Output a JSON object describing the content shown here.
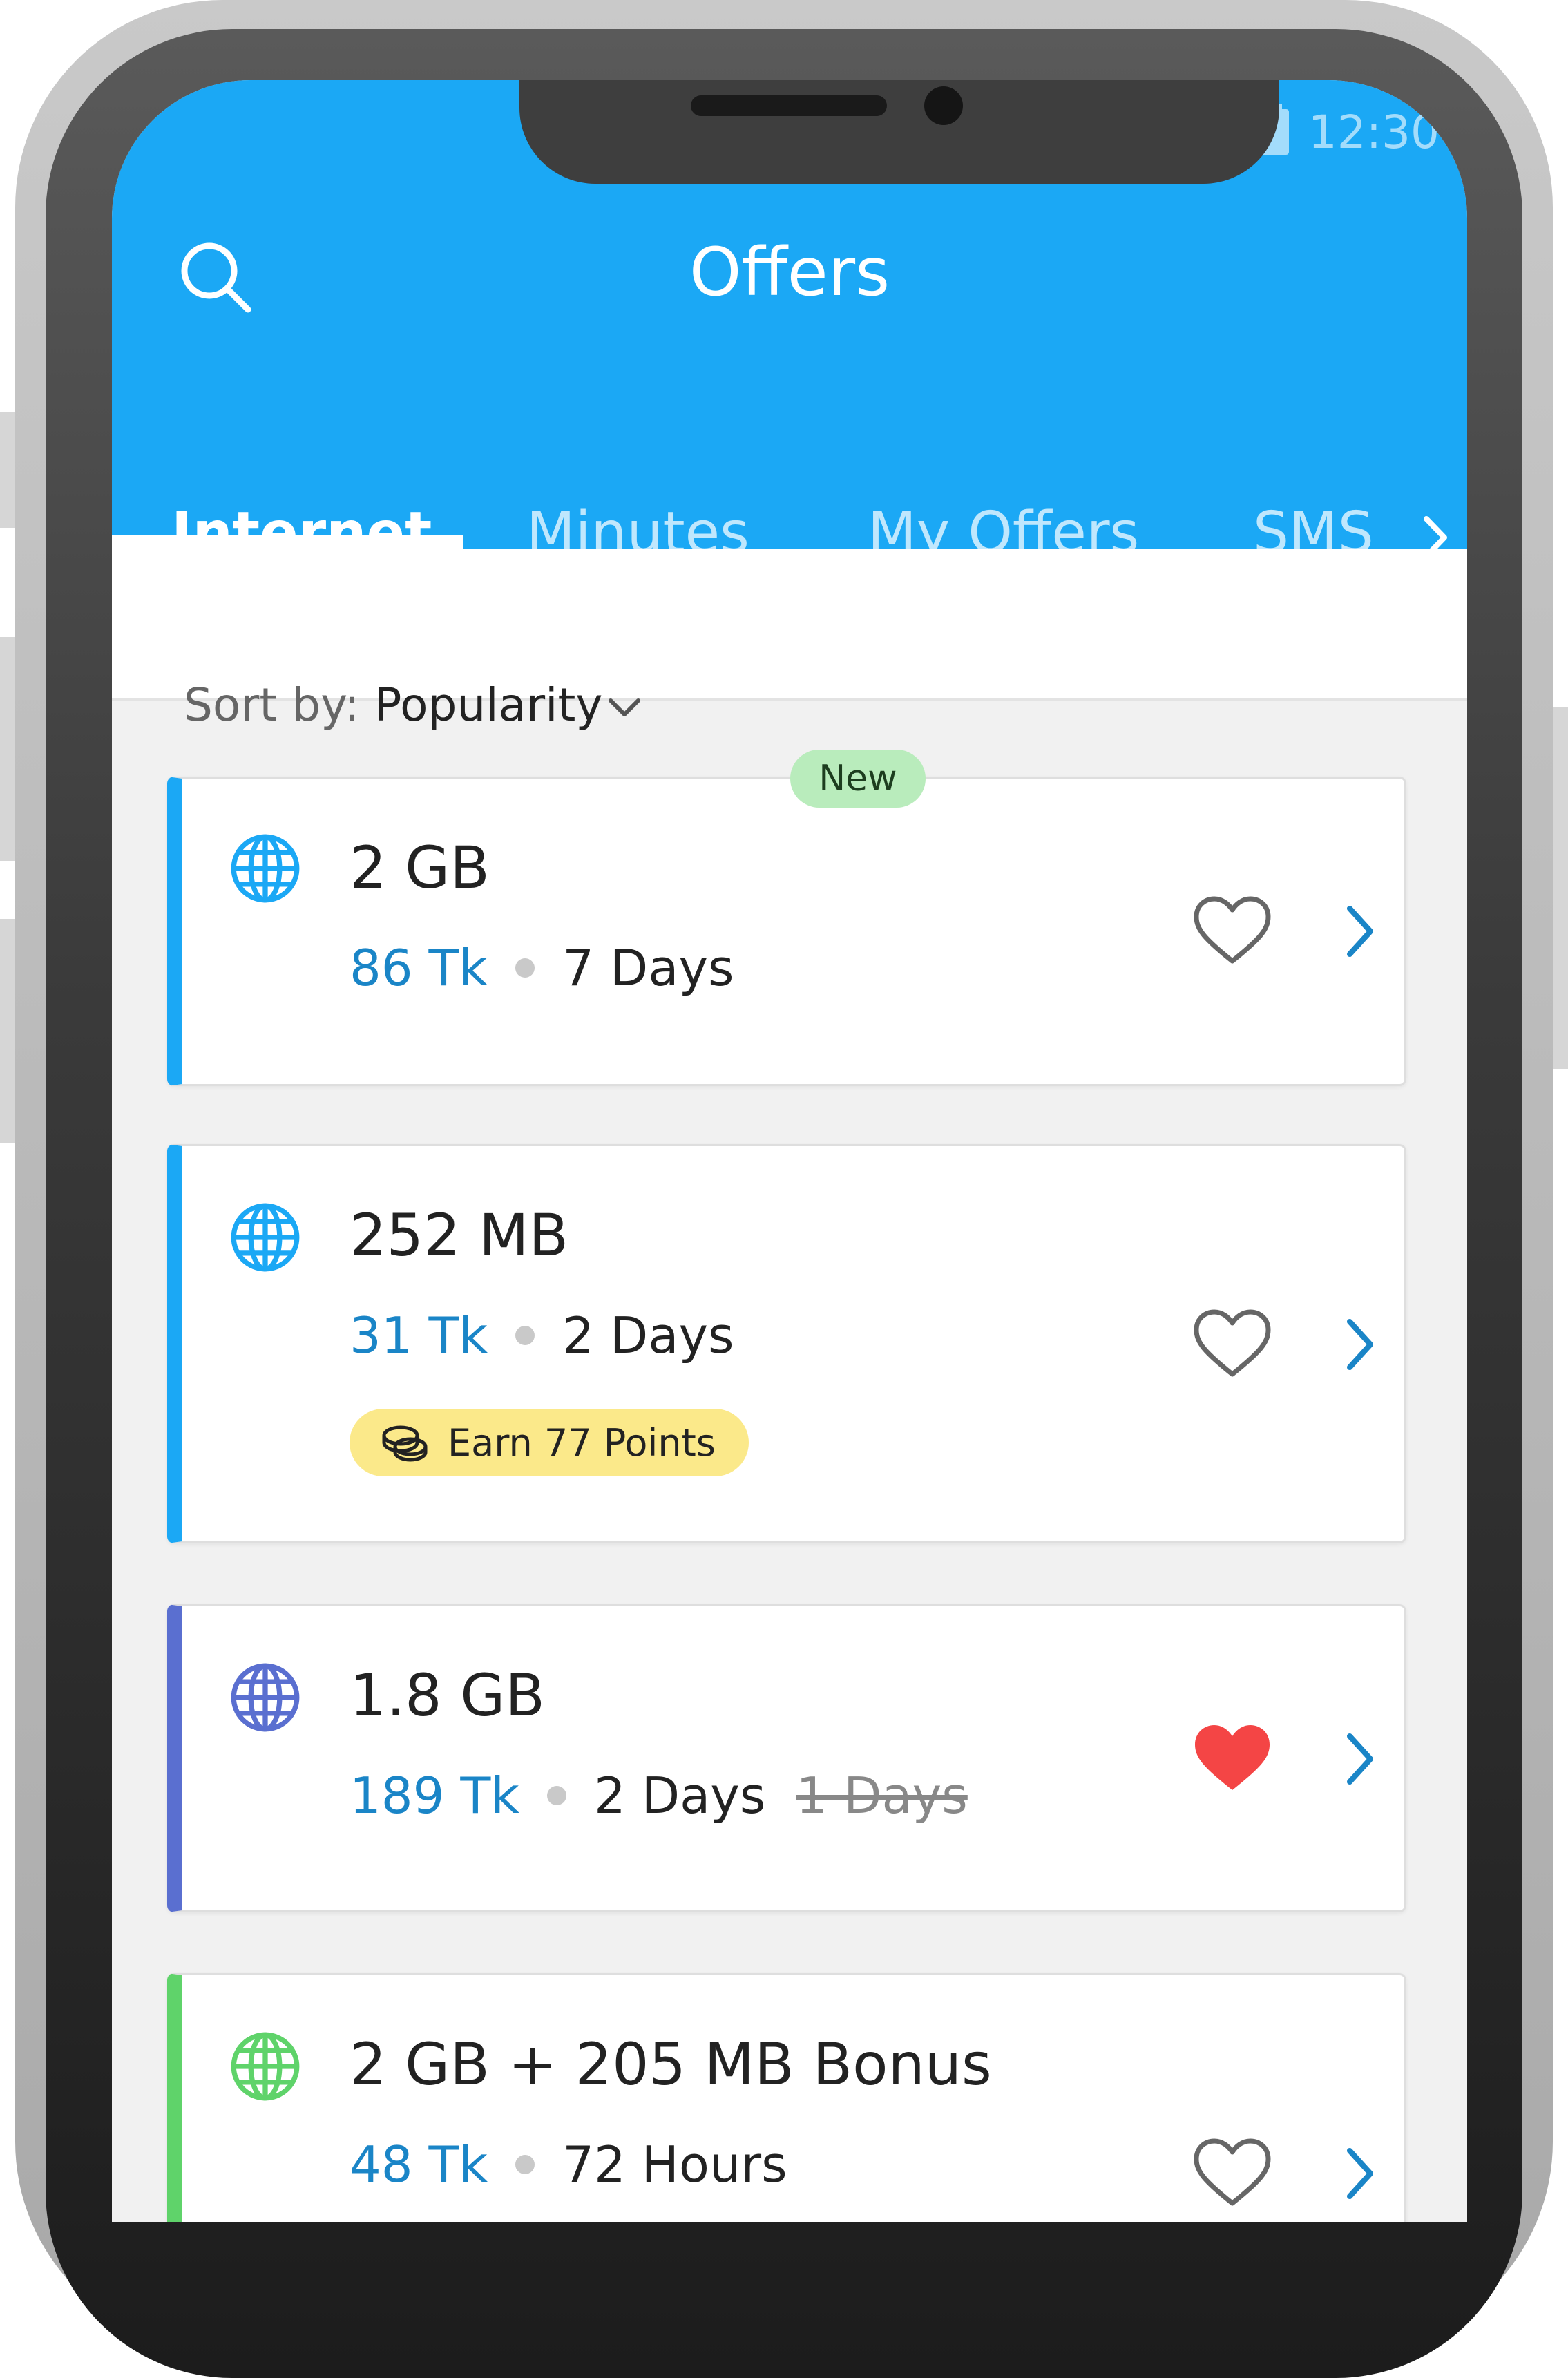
{
  "status_bar": {
    "time": "12:30"
  },
  "header": {
    "title": "Offers",
    "search_icon": "search-icon"
  },
  "tabs": [
    {
      "label": "Internet",
      "active": true
    },
    {
      "label": "Minutes",
      "active": false
    },
    {
      "label": "My Offers",
      "active": false
    },
    {
      "label": "SMS",
      "active": false
    }
  ],
  "sort": {
    "label": "Sort by:",
    "value": "Popularity"
  },
  "offers": [
    {
      "title": "2 GB",
      "price": "86 Tk",
      "duration": "7 Days",
      "badge": "New",
      "favorite": false,
      "accent": "#1ba8f5"
    },
    {
      "title": "252 MB",
      "price": "31 Tk",
      "duration": "2 Days",
      "points": "Earn 77 Points",
      "favorite": false,
      "accent": "#1ba8f5"
    },
    {
      "title": "1.8 GB",
      "price": "189 Tk",
      "duration": "2 Days",
      "old_duration": "1 Days",
      "favorite": true,
      "accent": "#5a6fd0"
    },
    {
      "title": "2 GB + 205 MB Bonus",
      "price": "48 Tk",
      "duration": "72 Hours",
      "favorite": false,
      "accent": "#5fd36a"
    }
  ],
  "colors": {
    "primary": "#1ba8f5",
    "price": "#1a85c7",
    "favorite_active": "#f44545",
    "new_badge": "#b9ecbc",
    "points_badge": "#fbe98a"
  }
}
